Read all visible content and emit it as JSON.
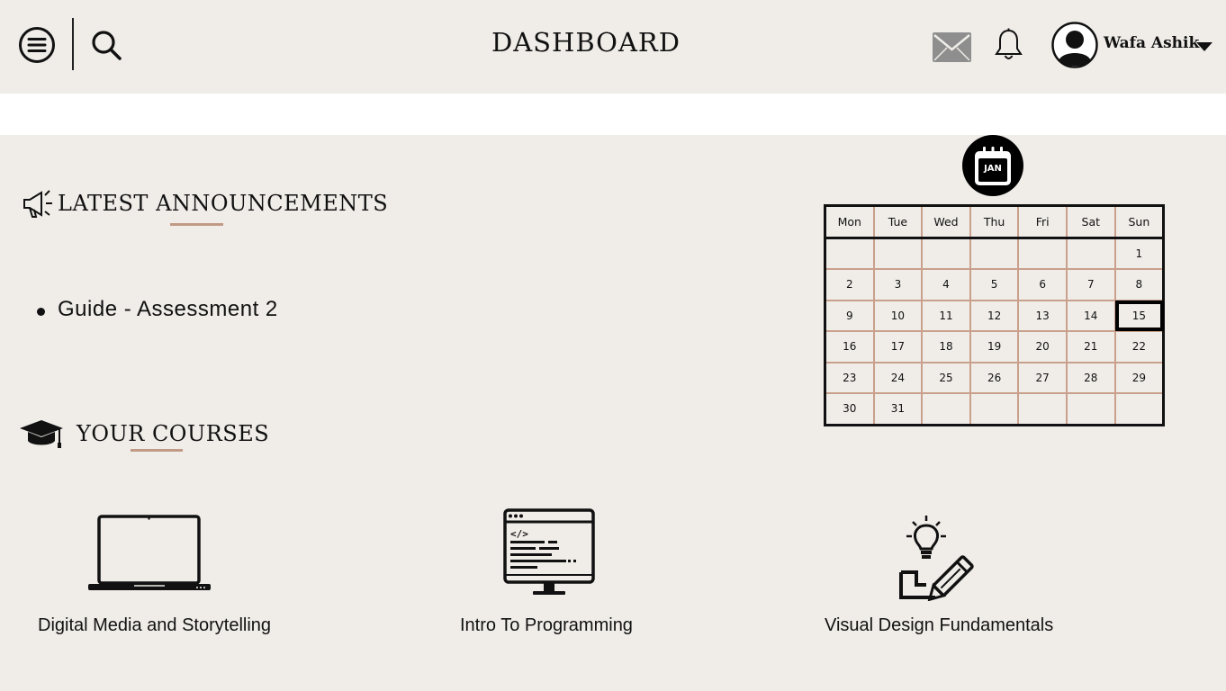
{
  "header": {
    "title": "DASHBOARD",
    "user_name": "Wafa Ashik",
    "icons": [
      "menu-icon",
      "search-icon",
      "mail-icon",
      "bell-icon",
      "avatar-icon",
      "caret-down-icon"
    ]
  },
  "announcements": {
    "title": "LATEST ANNOUNCEMENTS",
    "items": [
      "Guide - Assessment 2"
    ]
  },
  "courses": {
    "title": "YOUR COURSES",
    "items": [
      {
        "label": "Digital Media and Storytelling",
        "icon": "laptop-icon"
      },
      {
        "label": "Intro To Programming",
        "icon": "code-monitor-icon"
      },
      {
        "label": "Visual Design Fundamentals",
        "icon": "lightbulb-pencil-icon"
      }
    ]
  },
  "calendar": {
    "month_badge": "JAN",
    "weekdays": [
      "Mon",
      "Tue",
      "Wed",
      "Thu",
      "Fri",
      "Sat",
      "Sun"
    ],
    "weeks": [
      [
        "",
        "",
        "",
        "",
        "",
        "",
        "1"
      ],
      [
        "2",
        "3",
        "4",
        "5",
        "6",
        "7",
        "8"
      ],
      [
        "9",
        "10",
        "11",
        "12",
        "13",
        "14",
        "15"
      ],
      [
        "16",
        "17",
        "18",
        "19",
        "20",
        "21",
        "22"
      ],
      [
        "23",
        "24",
        "25",
        "26",
        "27",
        "28",
        "29"
      ],
      [
        "30",
        "31",
        "",
        "",
        "",
        "",
        ""
      ]
    ],
    "today": "15"
  },
  "colors": {
    "background": "#f0ede9",
    "accent_underline": "#c19a85",
    "calendar_grid": "#c9a08c",
    "mail_icon": "#8e8e8e"
  }
}
